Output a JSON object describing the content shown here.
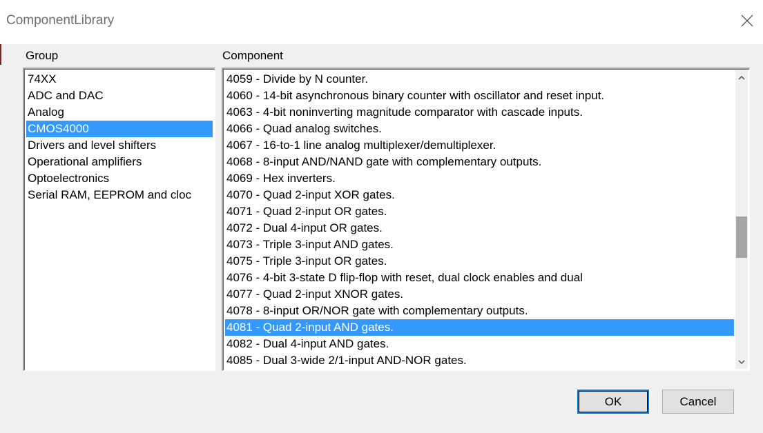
{
  "window": {
    "title": "ComponentLibrary"
  },
  "group": {
    "label": "Group",
    "items": [
      {
        "label": "74XX",
        "selected": false
      },
      {
        "label": "ADC and DAC",
        "selected": false
      },
      {
        "label": "Analog",
        "selected": false
      },
      {
        "label": "CMOS4000",
        "selected": true
      },
      {
        "label": "Drivers and level shifters",
        "selected": false
      },
      {
        "label": "Operational amplifiers",
        "selected": false
      },
      {
        "label": "Optoelectronics",
        "selected": false
      },
      {
        "label": "Serial RAM, EEPROM and cloc",
        "selected": false
      }
    ]
  },
  "component": {
    "label": "Component",
    "items": [
      {
        "label": "4059 - Divide by N counter.",
        "selected": false
      },
      {
        "label": "4060 - 14-bit asynchronous binary counter with oscillator and reset input.",
        "selected": false
      },
      {
        "label": "4063 - 4-bit noninverting magnitude comparator with cascade inputs.",
        "selected": false
      },
      {
        "label": "4066 - Quad analog switches.",
        "selected": false
      },
      {
        "label": "4067 - 16-to-1 line analog multiplexer/demultiplexer.",
        "selected": false
      },
      {
        "label": "4068 - 8-input AND/NAND gate with complementary outputs.",
        "selected": false
      },
      {
        "label": "4069 - Hex inverters.",
        "selected": false
      },
      {
        "label": "4070 - Quad 2-input XOR gates.",
        "selected": false
      },
      {
        "label": "4071 - Quad 2-input OR gates.",
        "selected": false
      },
      {
        "label": "4072 - Dual 4-input OR gates.",
        "selected": false
      },
      {
        "label": "4073 - Triple 3-input AND gates.",
        "selected": false
      },
      {
        "label": "4075 - Triple 3-input OR gates.",
        "selected": false
      },
      {
        "label": "4076 - 4-bit 3-state D flip-flop with reset, dual clock enables and dual",
        "selected": false
      },
      {
        "label": "4077 - Quad 2-input XNOR gates.",
        "selected": false
      },
      {
        "label": "4078 - 8-input OR/NOR gate with complementary outputs.",
        "selected": false
      },
      {
        "label": "4081 - Quad 2-input AND gates.",
        "selected": true
      },
      {
        "label": "4082 - Dual 4-input AND gates.",
        "selected": false
      },
      {
        "label": "4085 - Dual 3-wide 2/1-input AND-NOR gates.",
        "selected": false
      }
    ]
  },
  "buttons": {
    "ok": "OK",
    "cancel": "Cancel"
  },
  "icons": {
    "close": "close-icon",
    "scroll_up": "chevron-up-icon",
    "scroll_down": "chevron-down-icon"
  },
  "colors": {
    "selection": "#3399ff",
    "default_button_border": "#0078d7"
  }
}
